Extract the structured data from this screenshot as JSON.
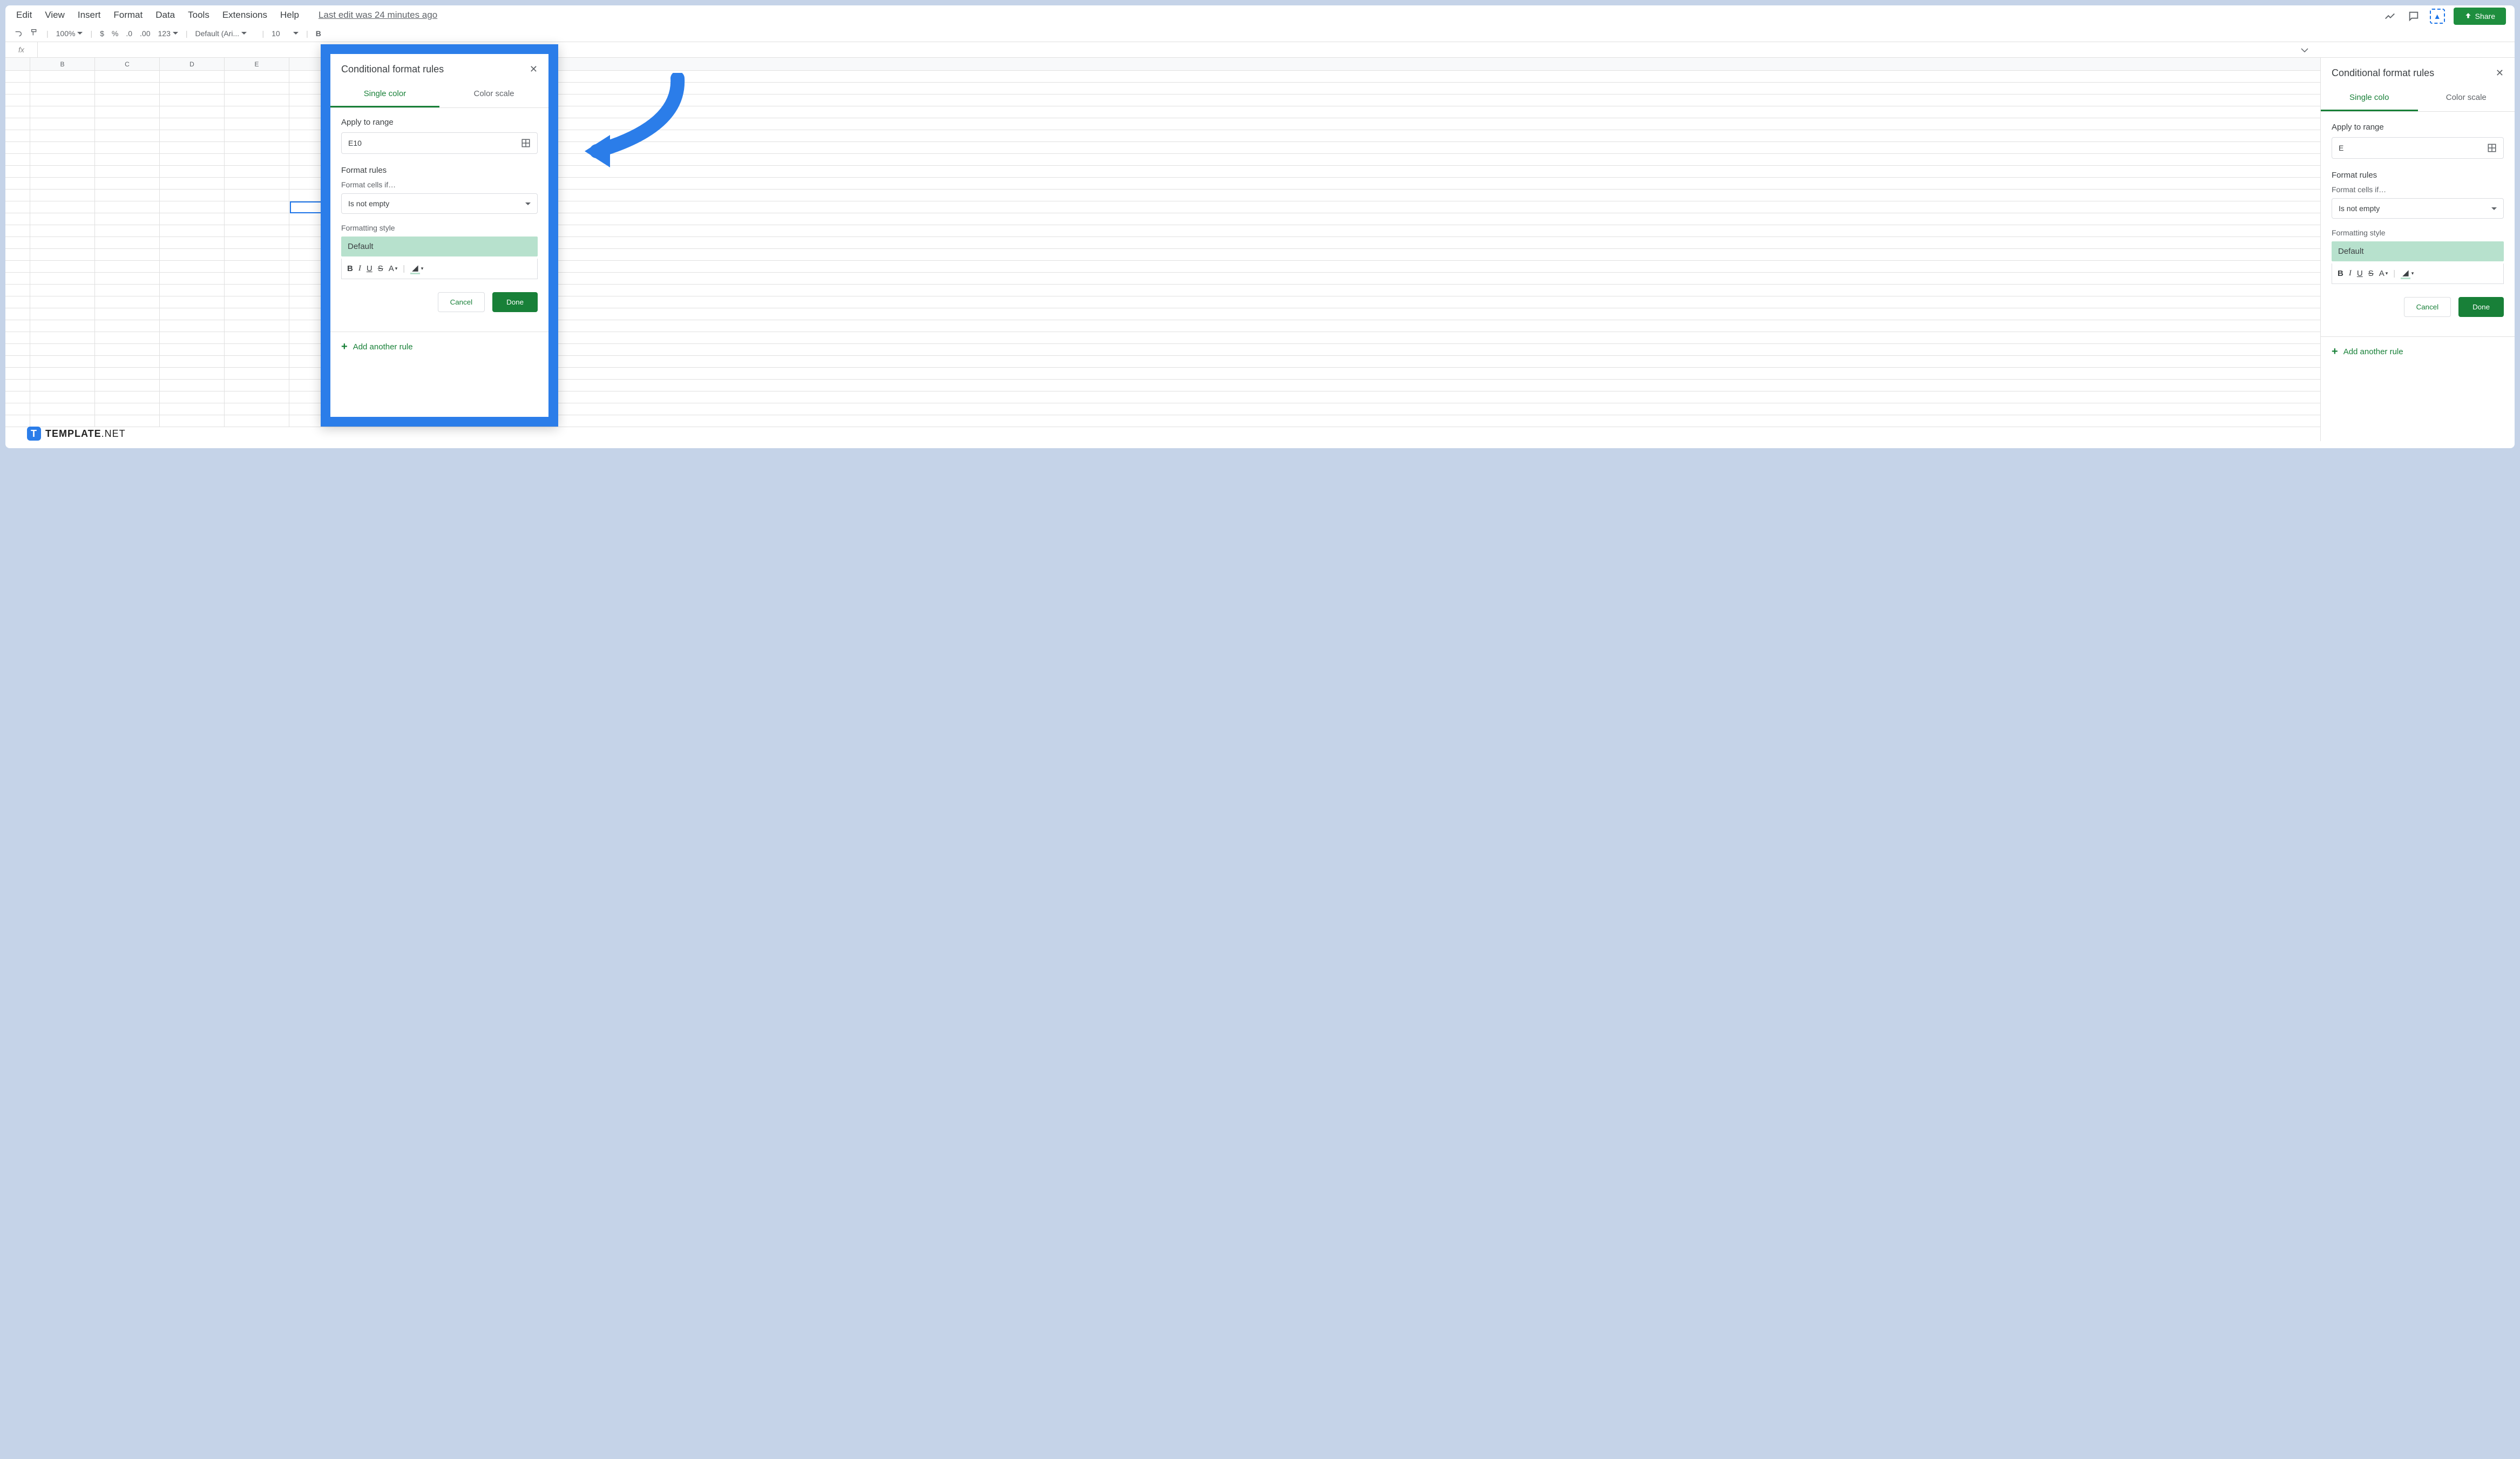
{
  "menu": {
    "edit": "Edit",
    "view": "View",
    "insert": "Insert",
    "format": "Format",
    "data": "Data",
    "tools": "Tools",
    "extensions": "Extensions",
    "help": "Help",
    "lastedit": "Last edit was 24 minutes ago"
  },
  "share": "Share",
  "toolbar": {
    "zoom": "100%",
    "currency": "$",
    "percent": "%",
    "dec_dec": ".0",
    "dec_inc": ".00",
    "num": "123",
    "font": "Default (Ari...",
    "size": "10",
    "bold": "B"
  },
  "fx": "fx",
  "columns": [
    "B",
    "C",
    "D",
    "E"
  ],
  "panel": {
    "title": "Conditional format rules",
    "tab1": "Single color",
    "tab2": "Color scale",
    "apply_label": "Apply to range",
    "range": "E10",
    "rules_label": "Format rules",
    "cells_if": "Format cells if…",
    "condition": "Is not empty",
    "style_label": "Formatting style",
    "default": "Default",
    "cancel": "Cancel",
    "done": "Done",
    "addrule": "Add another rule"
  },
  "sidepanel": {
    "tab1": "Single colo",
    "range": "E"
  },
  "brand": {
    "name": "TEMPLATE",
    "suffix": ".NET",
    "t": "T"
  }
}
